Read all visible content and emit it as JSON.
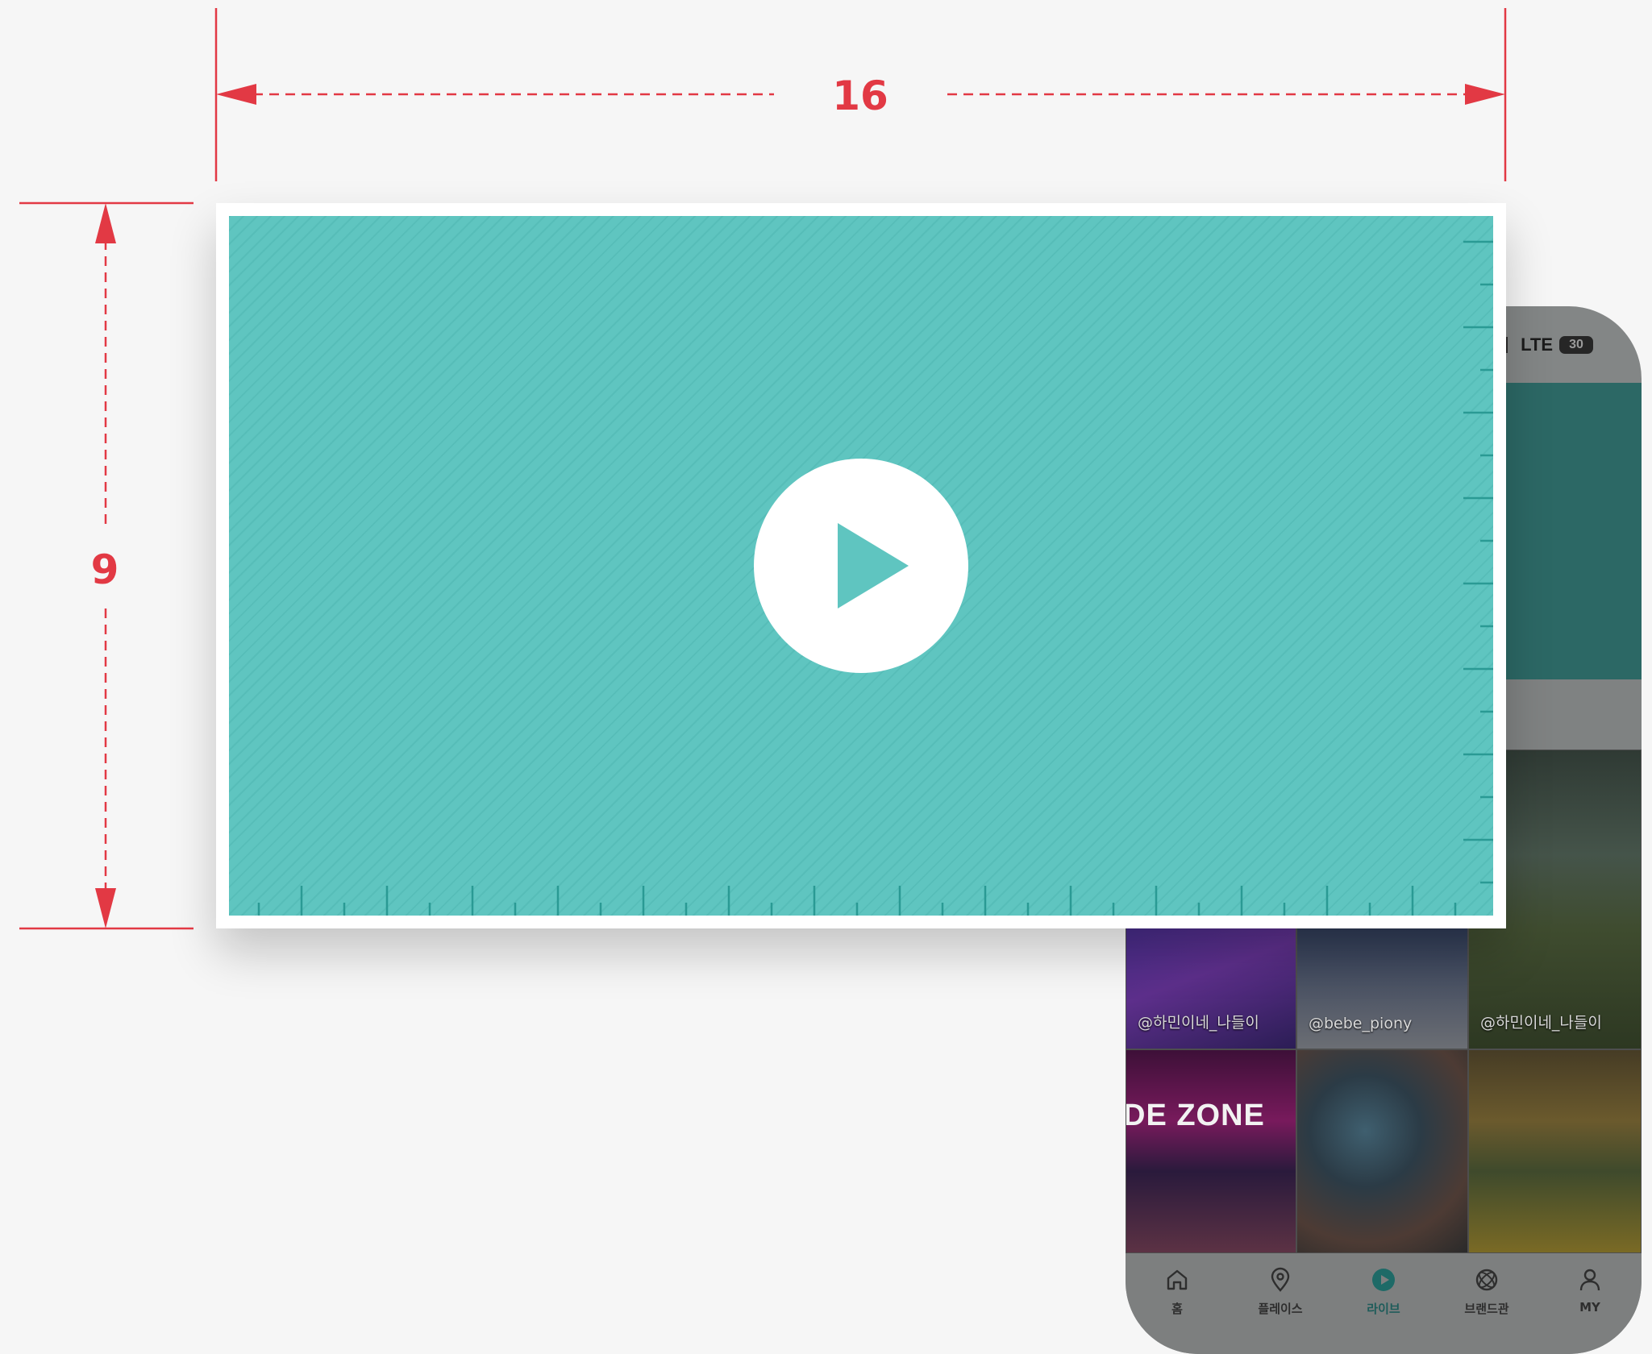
{
  "dimensions": {
    "width_label": "16",
    "height_label": "9",
    "color": "#e23944"
  },
  "video_card": {
    "background": "#5fc5c0",
    "frame_color": "#ffffff",
    "play_icon": "play-icon"
  },
  "phone": {
    "status_bar": {
      "network": "LTE",
      "battery": "30",
      "icons": [
        "signal-icon",
        "battery-icon"
      ]
    },
    "banner_color": "#2c6865",
    "grid": [
      {
        "handle": "@하민이네_나들이"
      },
      {
        "handle": "@bebe_piony"
      },
      {
        "handle": "@하민이네_나들이"
      },
      {
        "sign_text": "DE ZONE"
      },
      {
        "handle": ""
      },
      {
        "handle": ""
      }
    ],
    "tabs": [
      {
        "label": "홈",
        "icon": "home-icon",
        "active": false
      },
      {
        "label": "플레이스",
        "icon": "location-pin-icon",
        "active": false
      },
      {
        "label": "라이브",
        "icon": "play-circle-icon",
        "active": true
      },
      {
        "label": "브랜드관",
        "icon": "brand-icon",
        "active": false
      },
      {
        "label": "MY",
        "icon": "person-icon",
        "active": false
      }
    ]
  }
}
